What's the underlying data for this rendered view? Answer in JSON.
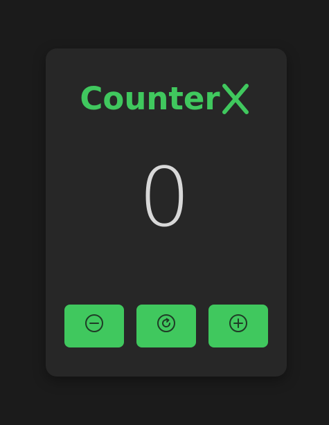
{
  "app": {
    "title": "Counter",
    "title_suffix_glyph": "X-icon"
  },
  "counter": {
    "value": "0"
  },
  "controls": {
    "decrement_icon": "minus-circle-icon",
    "reset_icon": "refresh-icon",
    "increment_icon": "plus-circle-icon"
  },
  "colors": {
    "accent": "#40c85e",
    "card": "#272727",
    "background": "#1b1b1b",
    "counter_text": "#d8d8d8"
  }
}
